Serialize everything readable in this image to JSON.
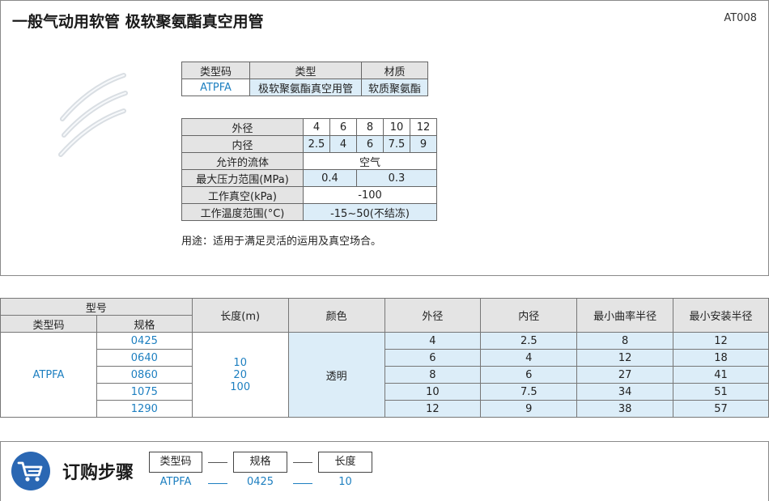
{
  "header": {
    "title": "一般气动用软管  极软聚氨酯真空用管",
    "code": "AT008"
  },
  "type_table": {
    "headers": [
      "类型码",
      "类型",
      "材质"
    ],
    "row": [
      "ATPFA",
      "极软聚氨酯真空用管",
      "软质聚氨酯"
    ]
  },
  "spec_table": {
    "od_label": "外径",
    "od": [
      "4",
      "6",
      "8",
      "10",
      "12"
    ],
    "id_label": "内径",
    "id": [
      "2.5",
      "4",
      "6",
      "7.5",
      "9"
    ],
    "fluid_label": "允许的流体",
    "fluid": "空气",
    "pressure_label": "最大压力范围(MPa)",
    "pressure": [
      "0.4",
      "0.3"
    ],
    "vacuum_label": "工作真空(kPa)",
    "vacuum": "-100",
    "temp_label": "工作温度范围(°C)",
    "temp": "-15~50(不结冻)"
  },
  "usage": "用途：适用于满足灵活的运用及真空场合。",
  "product_table": {
    "model_header": "型号",
    "type_code_header": "类型码",
    "spec_header": "规格",
    "length_header": "长度(m)",
    "color_header": "颜色",
    "od_header": "外径",
    "id_header": "内径",
    "min_bend_header": "最小曲率半径",
    "min_install_header": "最小安装半径",
    "type_code": "ATPFA",
    "lengths": [
      "10",
      "20",
      "100"
    ],
    "color": "透明",
    "rows": [
      {
        "spec": "0425",
        "od": "4",
        "id": "2.5",
        "bend": "8",
        "install": "12"
      },
      {
        "spec": "0640",
        "od": "6",
        "id": "4",
        "bend": "12",
        "install": "18"
      },
      {
        "spec": "0860",
        "od": "8",
        "id": "6",
        "bend": "27",
        "install": "41"
      },
      {
        "spec": "1075",
        "od": "10",
        "id": "7.5",
        "bend": "34",
        "install": "51"
      },
      {
        "spec": "1290",
        "od": "12",
        "id": "9",
        "bend": "38",
        "install": "57"
      }
    ]
  },
  "order": {
    "title": "订购步骤",
    "icon": "shopping-cart-icon",
    "steps": [
      "类型码",
      "规格",
      "长度"
    ],
    "example": [
      "ATPFA",
      "0425",
      "10"
    ]
  },
  "colors": {
    "accent_blue": "#1d7fc0",
    "light_blue": "#dcedf8",
    "cart_blue": "#2a67b3"
  }
}
